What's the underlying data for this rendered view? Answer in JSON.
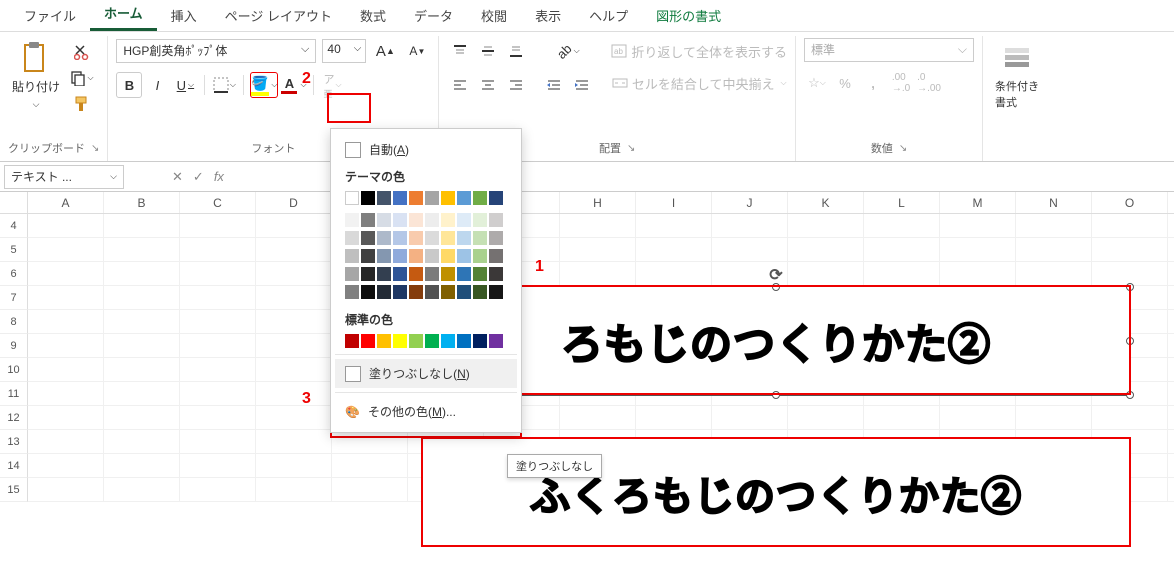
{
  "tabs": [
    "ファイル",
    "ホーム",
    "挿入",
    "ページ レイアウト",
    "数式",
    "データ",
    "校閲",
    "表示",
    "ヘルプ",
    "図形の書式"
  ],
  "active_tab_index": 1,
  "clipboard": {
    "paste_label": "貼り付け",
    "group_label": "クリップボード"
  },
  "font": {
    "name": "HGP創英角ﾎﾟｯﾌﾟ体",
    "size": "40",
    "group_label": "フォント",
    "bold": "B",
    "italic": "I",
    "underline": "U"
  },
  "alignment": {
    "group_label": "配置",
    "wrap_label": "折り返して全体を表示する",
    "merge_label": "セルを結合して中央揃え"
  },
  "number": {
    "group_label": "数値",
    "format": "標準"
  },
  "styles": {
    "cond_format": "条件付き\n書式"
  },
  "namebox": "テキスト ...",
  "dropdown": {
    "auto": "自動(A)",
    "theme_label": "テーマの色",
    "standard_label": "標準の色",
    "no_fill": "塗りつぶしなし(N)",
    "more_colors": "その他の色(M)...",
    "tooltip": "塗りつぶしなし",
    "theme_colors_row1": [
      "#ffffff",
      "#000000",
      "#44546a",
      "#4472c4",
      "#ed7d31",
      "#a5a5a5",
      "#ffc000",
      "#5b9bd5",
      "#70ad47",
      "#264478"
    ],
    "theme_tints": [
      [
        "#f2f2f2",
        "#7f7f7f",
        "#d6dce5",
        "#d9e2f3",
        "#fbe5d6",
        "#ededed",
        "#fff2cc",
        "#deebf7",
        "#e2f0d9",
        "#d0cece"
      ],
      [
        "#d9d9d9",
        "#595959",
        "#adb9ca",
        "#b4c7e7",
        "#f8cbad",
        "#dbdbdb",
        "#ffe699",
        "#bdd7ee",
        "#c5e0b4",
        "#aeabab"
      ],
      [
        "#bfbfbf",
        "#404040",
        "#8497b0",
        "#8faadc",
        "#f4b183",
        "#c9c9c9",
        "#ffd966",
        "#9dc3e6",
        "#a9d18e",
        "#757171"
      ],
      [
        "#a6a6a6",
        "#262626",
        "#333f50",
        "#2f5597",
        "#c55a11",
        "#7b7b7b",
        "#bf9000",
        "#2e75b6",
        "#548235",
        "#3b3838"
      ],
      [
        "#808080",
        "#0d0d0d",
        "#222a35",
        "#1f3864",
        "#843c0c",
        "#525252",
        "#806000",
        "#1f4e79",
        "#385723",
        "#161616"
      ]
    ],
    "standard_colors": [
      "#c00000",
      "#ff0000",
      "#ffc000",
      "#ffff00",
      "#92d050",
      "#00b050",
      "#00b0f0",
      "#0070c0",
      "#002060",
      "#7030a0"
    ]
  },
  "columns": [
    "A",
    "B",
    "C",
    "D",
    "",
    "",
    "",
    "H",
    "I",
    "J",
    "K",
    "L",
    "M",
    "N",
    "O"
  ],
  "rows": [
    4,
    5,
    6,
    7,
    8,
    9,
    10,
    11,
    12,
    13,
    14,
    15
  ],
  "shape_text": "ろもじのつくりかた②",
  "shape_text2": "ふくろもじのつくりかた②",
  "annotations": {
    "a1": "1",
    "a2": "2",
    "a3": "3"
  }
}
